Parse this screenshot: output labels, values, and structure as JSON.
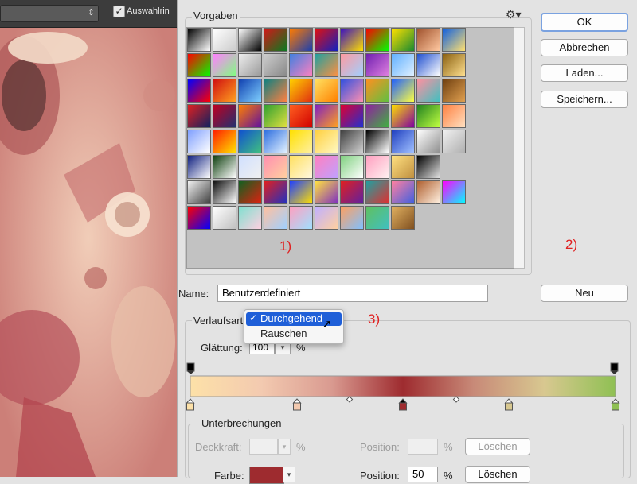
{
  "topbar": {
    "checkbox_label": "Auswahlrin",
    "checkbox_mark": "✓",
    "dropdown_arrow": "⇕"
  },
  "presets": {
    "label": "Vorgaben",
    "gear_icon": "⚙▾",
    "annotation": "1)",
    "rows": [
      [
        "bw",
        "trans-bw",
        "wb",
        "rg",
        "orange-blue",
        "red-blue",
        "yellow-pink",
        "rainbow",
        "yellow-green",
        "copper",
        "blue-yellow"
      ],
      [
        "rainbow",
        "trans-rainbow",
        "trans-grey",
        "checker",
        "blue-pink",
        "teal-orange",
        "pastel",
        "purple",
        "sky",
        "blue-white",
        "gold"
      ],
      [
        "rainbow2",
        "red-orange",
        "blue-sky",
        "teal-orange2",
        "yellow-red",
        "yellow-orange",
        "blue-pink2",
        "orange-green",
        "blue-yellow2",
        "pink-teal",
        "bronze"
      ],
      [
        "red-navy",
        "red-navy2",
        "orange-purple",
        "green-yellow",
        "orange-red",
        "violet-orange",
        "red-blue2",
        "purple-green",
        "yellow-purple",
        "green-lime",
        "orange-stripe"
      ],
      [
        "blue-stripe",
        "red-yellow",
        "blue-green",
        "blue-white2",
        "yellow-stripe",
        "yellow-stripe2",
        "grey-stripe",
        "black-white",
        "blue-stripe2",
        "white-grey",
        "trans-check"
      ],
      [
        "navy-white",
        "green-white",
        "trans-blue",
        "pink-peach",
        "yellow-white",
        "pink-lav",
        "green-white2",
        "pink-white",
        "yellow-gold",
        "black-white2",
        "empty"
      ],
      [
        "check-black",
        "black-white3",
        "green-red",
        "red-blue3",
        "blue-yellow3",
        "yellow-violet",
        "red-violet",
        "teal-red",
        "pink-blue",
        "copper-white",
        "rainbow3"
      ],
      [
        "rainbow4",
        "check-white",
        "pastel-teal",
        "peach-sky",
        "pink-sky",
        "lav-peach",
        "orange-sky",
        "green-teal",
        "gold-dark",
        "empty",
        "empty"
      ]
    ],
    "colors": {
      "bw": [
        "#000",
        "#fff"
      ],
      "trans-bw": [
        "#fff",
        "#ccc"
      ],
      "wb": [
        "#fff",
        "#000"
      ],
      "rg": [
        "#d01818",
        "#0a7a20"
      ],
      "orange-blue": [
        "#ff7a00",
        "#1a3fb0"
      ],
      "red-blue": [
        "#e01010",
        "#1020c0"
      ],
      "yellow-pink": [
        "#3a10c0",
        "#ffe000"
      ],
      "rainbow": [
        "#ff0000",
        "#00ff00"
      ],
      "yellow-green": [
        "#ffe000",
        "#1a8a30"
      ],
      "copper": [
        "#a0522d",
        "#ffc8a0"
      ],
      "blue-yellow": [
        "#1060e0",
        "#ffe070"
      ],
      "trans-rainbow": [
        "#ff80ff",
        "#80ff80"
      ],
      "trans-grey": [
        "#eee",
        "#999"
      ],
      "checker": [
        "#ccc",
        "#888"
      ],
      "blue-pink": [
        "#4080e0",
        "#ff80c0"
      ],
      "teal-orange": [
        "#20a0a0",
        "#ff9040"
      ],
      "pastel": [
        "#ff9aa0",
        "#a0d0ff"
      ],
      "purple": [
        "#7020b0",
        "#e080e0"
      ],
      "sky": [
        "#60b0ff",
        "#e0f0ff"
      ],
      "blue-white": [
        "#2050d0",
        "#ffffff"
      ],
      "gold": [
        "#8a6010",
        "#ffe090"
      ],
      "rainbow2": [
        "#0000ff",
        "#ff0000"
      ],
      "red-orange": [
        "#d01010",
        "#ffa020"
      ],
      "blue-sky": [
        "#1040b0",
        "#80d0ff"
      ],
      "teal-orange2": [
        "#108080",
        "#ff8040"
      ],
      "yellow-red": [
        "#ffd000",
        "#e03010"
      ],
      "yellow-orange": [
        "#ffe060",
        "#ff8000"
      ],
      "blue-pink2": [
        "#3050e0",
        "#ff90b0"
      ],
      "orange-green": [
        "#ff9020",
        "#60c040"
      ],
      "blue-yellow2": [
        "#2060ff",
        "#ffff40"
      ],
      "pink-teal": [
        "#ff90a0",
        "#40c0c0"
      ],
      "bronze": [
        "#704010",
        "#e0a050"
      ],
      "red-navy": [
        "#e02020",
        "#102060"
      ],
      "red-navy2": [
        "#c00020",
        "#203070"
      ],
      "orange-purple": [
        "#ff8000",
        "#6010a0"
      ],
      "green-yellow": [
        "#30a030",
        "#e0e040"
      ],
      "orange-red": [
        "#ff6020",
        "#d00000"
      ],
      "violet-orange": [
        "#8020c0",
        "#ffa020"
      ],
      "red-blue2": [
        "#e00030",
        "#2030d0"
      ],
      "purple-green": [
        "#9020a0",
        "#40b040"
      ],
      "yellow-purple": [
        "#ffe000",
        "#8000a0"
      ],
      "green-lime": [
        "#208020",
        "#c0ff40"
      ],
      "orange-stripe": [
        "#ff8040",
        "#ffe0c0"
      ],
      "blue-stripe": [
        "#80a0ff",
        "#ffffff"
      ],
      "red-yellow": [
        "#ff2000",
        "#ffe000"
      ],
      "blue-green": [
        "#1050d0",
        "#40c080"
      ],
      "blue-white2": [
        "#3070e0",
        "#e0f0ff"
      ],
      "yellow-stripe": [
        "#ffe000",
        "#fff0a0"
      ],
      "yellow-stripe2": [
        "#ffd040",
        "#fff8c0"
      ],
      "grey-stripe": [
        "#404040",
        "#d0d0d0"
      ],
      "black-white": [
        "#000000",
        "#ffffff"
      ],
      "blue-stripe2": [
        "#2040c0",
        "#a0c0ff"
      ],
      "white-grey": [
        "#ffffff",
        "#909090"
      ],
      "trans-check": [
        "#f0f0f0",
        "#b0b0b0"
      ],
      "navy-white": [
        "#102080",
        "#ffffff"
      ],
      "green-white": [
        "#104010",
        "#ffffff"
      ],
      "trans-blue": [
        "#d0e0ff",
        "#f0f0f0"
      ],
      "pink-peach": [
        "#ff90b0",
        "#ffd0a0"
      ],
      "yellow-white": [
        "#ffe060",
        "#fff8e0"
      ],
      "pink-lav": [
        "#ff80c0",
        "#c0a0ff"
      ],
      "green-white2": [
        "#80d080",
        "#ffffff"
      ],
      "pink-white": [
        "#ffa0c0",
        "#fff0f0"
      ],
      "yellow-gold": [
        "#ffe080",
        "#c09040"
      ],
      "black-white2": [
        "#000000",
        "#e0e0e0"
      ],
      "empty": [
        "#c2c2c2",
        "#c2c2c2"
      ],
      "check-black": [
        "#f0f0f0",
        "#404040"
      ],
      "black-white3": [
        "#101010",
        "#ffffff"
      ],
      "green-red": [
        "#106020",
        "#e02010"
      ],
      "red-blue3": [
        "#e02020",
        "#2030c0"
      ],
      "blue-yellow3": [
        "#2040ff",
        "#ffe000"
      ],
      "yellow-violet": [
        "#ffe040",
        "#8030c0"
      ],
      "red-violet": [
        "#e02020",
        "#6020a0"
      ],
      "teal-red": [
        "#20a0a0",
        "#e03030"
      ],
      "pink-blue": [
        "#ff80a0",
        "#4060e0"
      ],
      "copper-white": [
        "#b06030",
        "#fff0e0"
      ],
      "rainbow3": [
        "#ff00ff",
        "#00ffff"
      ],
      "rainbow4": [
        "#ff0000",
        "#0000ff"
      ],
      "check-white": [
        "#ffffff",
        "#c0c0c0"
      ],
      "pastel-teal": [
        "#80e0d0",
        "#ffd0e0"
      ],
      "peach-sky": [
        "#ffc0a0",
        "#a0d0ff"
      ],
      "pink-sky": [
        "#ffa0c0",
        "#a0e0ff"
      ],
      "lav-peach": [
        "#c0b0ff",
        "#ffd0a0"
      ],
      "orange-sky": [
        "#ffa060",
        "#80c0ff"
      ],
      "green-teal": [
        "#60c060",
        "#40c0c0"
      ],
      "gold-dark": [
        "#e0b060",
        "#805020"
      ]
    }
  },
  "buttons": {
    "ok": "OK",
    "cancel": "Abbrechen",
    "load": "Laden...",
    "save": "Speichern...",
    "new": "Neu"
  },
  "annotation2": "2)",
  "annotation3": "3)",
  "name": {
    "label": "Name:",
    "value": "Benutzerdefiniert"
  },
  "gradient": {
    "type_label": "Verlaufsart:",
    "popup_check": "✓",
    "popup_options": [
      "Durchgehend",
      "Rauschen"
    ],
    "smoothness_label": "Glättung:",
    "smoothness_value": "100",
    "smoothness_unit": "%",
    "colors": [
      "#fde1a8",
      "#f3cab0",
      "#d99a90",
      "#9e2b2f",
      "#c88a78",
      "#d8c890",
      "#8fc053"
    ]
  },
  "stops": {
    "group_label": "Unterbrechungen",
    "opacity_label": "Deckkraft:",
    "opacity_unit": "%",
    "position_label": "Position:",
    "position_unit": "%",
    "delete_label": "Löschen",
    "color_label": "Farbe:",
    "color_position_value": "50",
    "color_swatch": "#9e2b2f"
  },
  "photo": {
    "tint": "#e8b6a4"
  }
}
